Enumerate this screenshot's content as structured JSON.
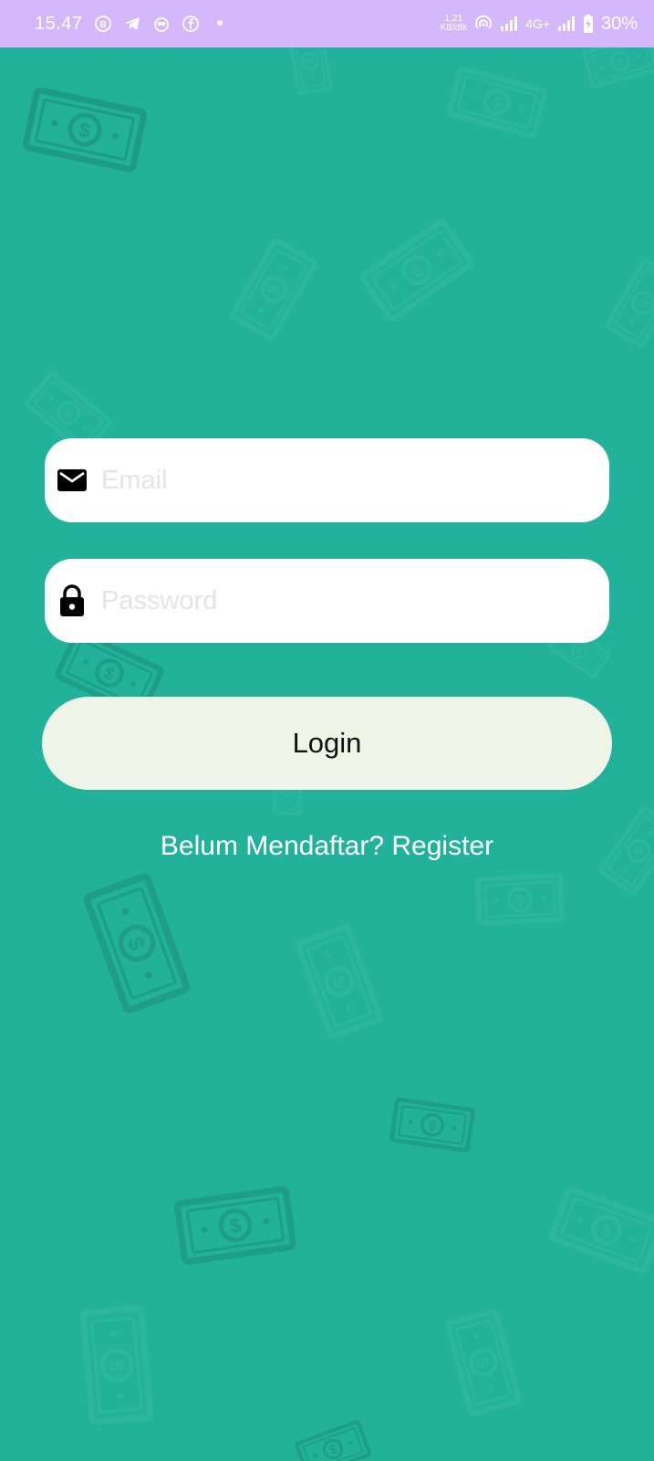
{
  "status_bar": {
    "time": "15.47",
    "notification_icons": [
      "b-app-icon",
      "telegram-icon",
      "bot-icon",
      "facebook-icon",
      "dot-icon"
    ],
    "speed_value": "1,21",
    "speed_unit": "KB/dtk",
    "network_type": "4G+",
    "battery_percent": "30%",
    "background_color": "#d5b8fb"
  },
  "background": {
    "color": "#22b29c",
    "pattern_icon": "dollar-bill-icon"
  },
  "login_form": {
    "email": {
      "placeholder": "Email",
      "value": "",
      "icon": "mail-icon"
    },
    "password": {
      "placeholder": "Password",
      "value": "",
      "icon": "lock-icon"
    },
    "login_label": "Login",
    "register_text": "Belum Mendaftar? Register"
  }
}
